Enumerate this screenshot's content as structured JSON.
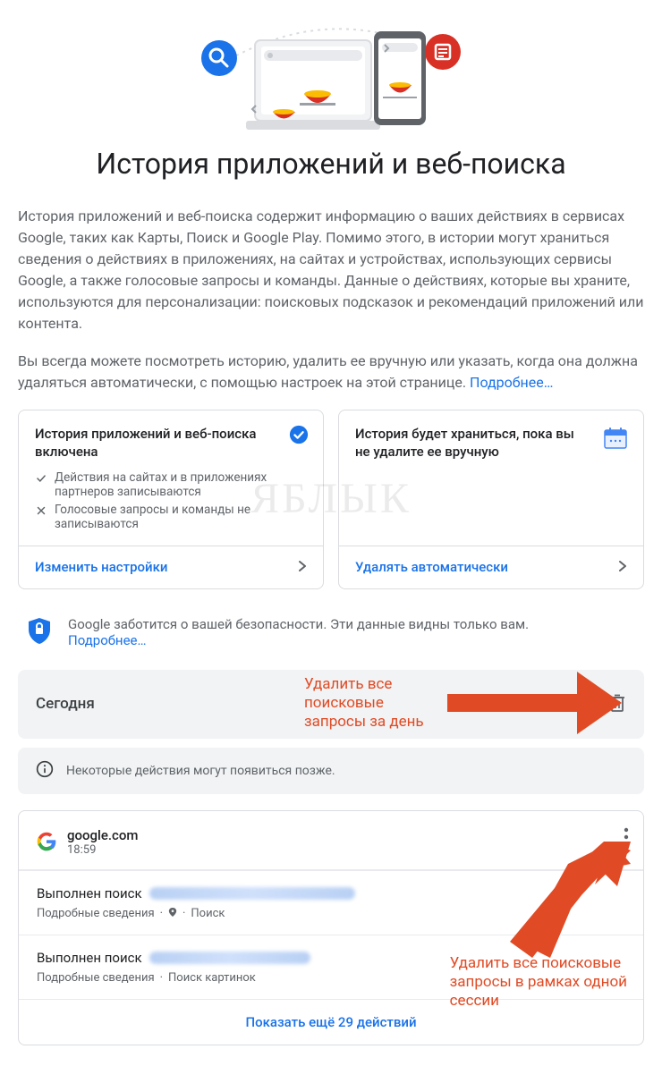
{
  "page": {
    "title": "История приложений и веб-поиска",
    "paragraph1": "История приложений и веб-поиска содержит информацию о ваших действиях в сервисах Google, таких как Карты, Поиск и Google Play. Помимо этого, в истории могут храниться сведения о действиях в приложениях, на сайтах и устройствах, использующих сервисы Google, а также голосовые запросы и команды. Данные о действиях, которые вы храните, используются для персонализации: поисковых подсказок и рекомендаций приложений или контента.",
    "paragraph2": "Вы всегда можете посмотреть историю, удалить ее вручную или указать, когда она должна удаляться автоматически, с помощью настроек на этой странице. ",
    "learn_more": "Подробнее…"
  },
  "cards": {
    "left": {
      "title": "История приложений и веб-поиска включена",
      "sub1": "Действия на сайтах и в приложениях партнеров записываются",
      "sub2": "Голосовые запросы и команды не записываются",
      "action": "Изменить настройки"
    },
    "right": {
      "title": "История будет храниться, пока вы не удалите ее вручную",
      "action": "Удалять автоматически"
    }
  },
  "security": {
    "text": "Google заботится о вашей безопасности. Эти данные видны только вам.",
    "learn_more": "Подробнее…"
  },
  "today": {
    "label": "Сегодня"
  },
  "info_bar": "Некоторые действия могут появиться позже.",
  "activity": {
    "site": "google.com",
    "time": "18:59",
    "rows": [
      {
        "prefix": "Выполнен поиск",
        "details": "Подробные сведения",
        "source": "Поиск",
        "has_location": true
      },
      {
        "prefix": "Выполнен поиск",
        "details": "Подробные сведения",
        "source": "Поиск картинок",
        "has_location": false
      }
    ],
    "show_more": "Показать ещё 29 действий"
  },
  "annotations": {
    "day": "Удалить все\nпоисковые\nзапросы за день",
    "session": "Удалить все поисковые\nзапросы в рамках одной\nсессии"
  },
  "watermark": "ЯБЛЫК"
}
